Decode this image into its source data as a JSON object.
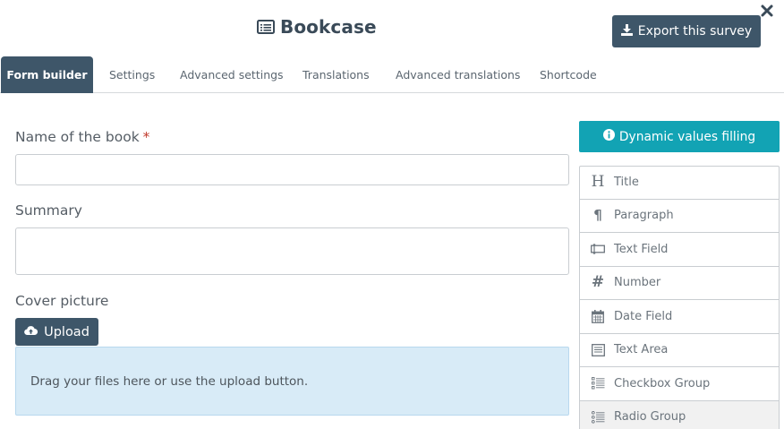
{
  "header": {
    "title": "Bookcase",
    "export_label": "Export this survey"
  },
  "tabs": [
    {
      "label": "Form builder"
    },
    {
      "label": "Settings"
    },
    {
      "label": "Advanced settings"
    },
    {
      "label": "Translations"
    },
    {
      "label": "Advanced translations"
    },
    {
      "label": "Shortcode"
    }
  ],
  "form": {
    "name_label": "Name of the book",
    "required_mark": "*",
    "name_value": "",
    "summary_label": "Summary",
    "summary_value": "",
    "cover_label": "Cover picture",
    "upload_label": "Upload",
    "dropzone_text": "Drag your files here or use the upload button."
  },
  "sidebar": {
    "dynamic_label": "Dynamic values filling",
    "items": [
      {
        "label": "Title",
        "icon": "heading-icon"
      },
      {
        "label": "Paragraph",
        "icon": "paragraph-icon"
      },
      {
        "label": "Text Field",
        "icon": "text-field-icon"
      },
      {
        "label": "Number",
        "icon": "hash-icon"
      },
      {
        "label": "Date Field",
        "icon": "calendar-icon"
      },
      {
        "label": "Text Area",
        "icon": "text-area-icon"
      },
      {
        "label": "Checkbox Group",
        "icon": "checkbox-list-icon"
      },
      {
        "label": "Radio Group",
        "icon": "radio-list-icon"
      }
    ]
  },
  "colors": {
    "primary": "#3e5669",
    "accent": "#12a3b4",
    "dropzone": "#d8ebf7",
    "required": "#c0392b"
  }
}
